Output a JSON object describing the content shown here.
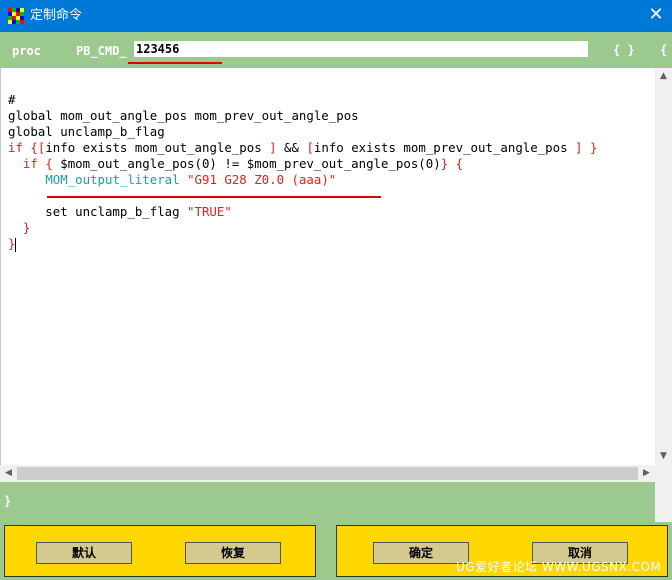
{
  "window": {
    "title": "定制命令",
    "close_glyph": "✕",
    "icon": "app-grid-icon"
  },
  "command": {
    "proc_label": "proc",
    "prefix": "PB_CMD_",
    "name_value": "123456",
    "open_brace_group": "{ }",
    "open_brace": "{"
  },
  "editor": {
    "lines": [
      "#",
      "global mom_out_angle_pos mom_prev_out_angle_pos",
      "global unclamp_b_flag",
      "if {[info exists mom_out_angle_pos ] && [info exists mom_prev_out_angle_pos ] }",
      "  if { $mom_out_angle_pos(0) != $mom_prev_out_angle_pos(0)} {",
      "     MOM_output_literal \"G91 G28 Z0.0 (aaa)\"",
      "",
      "     set unclamp_b_flag \"TRUE\"",
      "  }",
      "}"
    ],
    "colors": {
      "keyword": "#000000",
      "bracket": "#e0201a",
      "string": "#e0201a",
      "command": "#1aa0a0"
    }
  },
  "footer": {
    "close_brace": "}"
  },
  "buttons": {
    "default_label": "默认",
    "restore_label": "恢复",
    "ok_label": "确定",
    "cancel_label": "取消"
  },
  "watermark": "UG爱好者论坛 WWW.UGSNX.COM",
  "colors": {
    "titlebar": "#0078d7",
    "bar_green": "#9cc98e",
    "panel_yellow": "#ffd700",
    "button": "#d4c98e",
    "annotation_red": "#e00000"
  }
}
